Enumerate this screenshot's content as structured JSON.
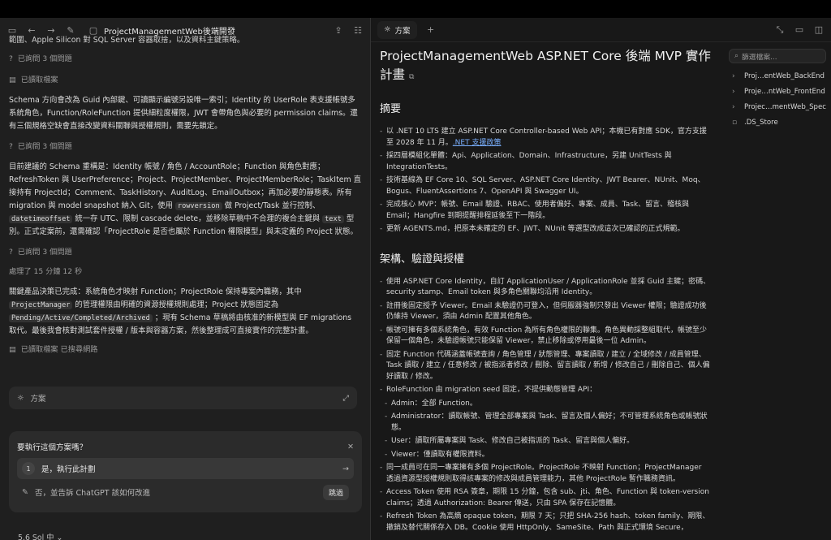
{
  "header": {
    "window_title": "ProjectManagementWeb後端開發",
    "right_tab": "方案"
  },
  "chat": {
    "top_cut": "範圍、Apple Silicon 對 SQL Server 容器取捨，以及資料主鍵策略。",
    "asked1": "已詢問 3 個問題",
    "read_file": "已讀取檔案",
    "para1": "Schema 方向會改為 Guid 內部鍵、可讀顯示編號另設唯一索引；Identity 的 UserRole 表支援帳號多系統角色，Function/RoleFunction 提供細粒度權限，JWT 會帶角色與必要的 permission claims。還有三個規格空缺會直接改變資料關聯與授權規則，需要先鎖定。",
    "asked2": "已詢問 3 個問題",
    "para2_a": "目前建議的 Schema 重構是：Identity 帳號 / 角色 / AccountRole；Function 與角色對應；RefreshToken 與 UserPreference；Project、ProjectMember、ProjectMemberRole；TaskItem 直接持有 ProjectId；Comment、TaskHistory、AuditLog、EmailOutbox；再加必要的靜態表。所有 migration 與 model snapshot 納入 Git，使用",
    "code_rowversion": "rowversion",
    "para2_b": "做 Project/Task 並行控制、",
    "code_datetimeoffset": "datetimeoffset",
    "para2_c": "統一存 UTC、限制 cascade delete，並移除草稿中不合理的複合主鍵與",
    "code_text": "text",
    "para2_d": "型別。正式定案前，還需確認「ProjectRole 是否也屬於 Function 權限模型」與未定義的 Project 狀態。",
    "asked3": "已詢問 3 個問題",
    "elapsed": "處理了 15 分鐘 12 秒",
    "para3_a": "關鍵產品決策已完成：系統角色才映射 Function；ProjectRole 保持專案內職務，其中",
    "code_pm": "ProjectManager",
    "para3_b": "的管理權限由明確的資源授權規則處理；Project 狀態固定為",
    "code_status": "Pending/Active/Completed/Archived",
    "para3_c": "；現有 Schema 草稿將由核准的新模型與 EF migrations 取代。最後我會核對測試套件授權 / 版本與容器方案，然後整理成可直接實作的完整計畫。",
    "read_search": "已讀取檔案 已搜尋網路",
    "plan_label": "方案"
  },
  "dialog": {
    "question": "要執行這個方案嗎？",
    "option1_num": "1",
    "option1_label": "是，執行此計劃",
    "option2_label": "否，並告訴 ChatGPT 該如何改進",
    "skip_label": "跳過"
  },
  "model_label": "5.6 Sol 中",
  "doc": {
    "title": "ProjectManagementWeb ASP.NET Core 後端 MVP 實作計畫",
    "h_summary": "摘要",
    "summary": [
      "以 .NET 10 LTS 建立 ASP.NET Core Controller-based Web API；本機已有對應 SDK，官方支援至 2028 年 11 月。",
      "採四層模組化單體：Api、Application、Domain、Infrastructure，另建 UnitTests 與 IntegrationTests。",
      "技術基線為 EF Core 10、SQL Server、ASP.NET Core Identity、JWT Bearer、NUnit、Moq、Bogus、FluentAssertions 7、OpenAPI 與 Swagger UI。",
      "完成核心 MVP：帳號、Email 驗證、RBAC、使用者偏好、專案、成員、Task、留言、稽核與 Email；Hangfire 到期提醒排程延後至下一階段。",
      "更新 AGENTS.md，把原本未確定的 EF、JWT、NUnit 等選型改成這次已確認的正式規範。"
    ],
    "link_text": ".NET 支援政策",
    "h_arch": "架構、驗證與授權",
    "arch": [
      "使用 ASP.NET Core Identity，自訂 ApplicationUser / ApplicationRole 並採 Guid 主鍵；密碼、security stamp、Email token 與多角色關聯均沿用 Identity。",
      "註冊後固定授予 Viewer。Email 未驗證仍可登入，但伺服器強制只發出 Viewer 權限；驗證成功後仍維持 Viewer，須由 Admin 配置其他角色。",
      "帳號可擁有多個系統角色，有效 Function 為所有角色權限的聯集。角色異動採整組取代，帳號至少保留一個角色，未驗證帳號只能保留 Viewer，禁止移除或停用最後一位 Admin。",
      "固定 Function 代碼涵蓋帳號查詢 / 角色管理 / 狀態管理、專案讀取 / 建立 / 全域修改 / 成員管理、Task 讀取 / 建立 / 任意修改 / 被指派者修改 / 刪除、留言讀取 / 新增 / 修改自己 / 刪除自己、個人偏好讀取 / 修改。",
      "RoleFunction 由 migration seed 固定，不提供動態管理 API："
    ],
    "roles": [
      "Admin：全部 Function。",
      "Administrator：讀取帳號、管理全部專案與 Task、留言及個人偏好；不可管理系統角色或帳號狀態。",
      "User：讀取所屬專案與 Task、修改自己被指派的 Task、留言與個人偏好。",
      "Viewer：僅讀取有權限資料。"
    ],
    "arch2": [
      "同一成員可在同一專案擁有多個 ProjectRole。ProjectRole 不映射 Function；ProjectManager 透過資源型授權規則取得該專案的修改與成員管理能力，其他 ProjectRole 暫作職務資訊。",
      "Access Token 使用 RSA 簽章，期限 15 分鐘，包含 sub、jti、角色、Function 與 token-version claims；透過 Authorization: Bearer 傳送，只由 SPA 保存在記憶體。",
      "Refresh Token 為高熵 opaque token，期限 7 天；只把 SHA-256 hash、token family、期限、撤銷及替代關係存入 DB。Cookie 使用 HttpOnly、SameSite、Path 與正式環境 Secure，"
    ]
  },
  "files": {
    "search_placeholder": "篩選檔案...",
    "items": [
      {
        "label": "Proj…entWeb_BackEnd",
        "type": "folder"
      },
      {
        "label": "Proje…ntWeb_FrontEnd",
        "type": "folder"
      },
      {
        "label": "Projec…mentWeb_Spec",
        "type": "folder"
      },
      {
        "label": ".DS_Store",
        "type": "file"
      }
    ]
  }
}
